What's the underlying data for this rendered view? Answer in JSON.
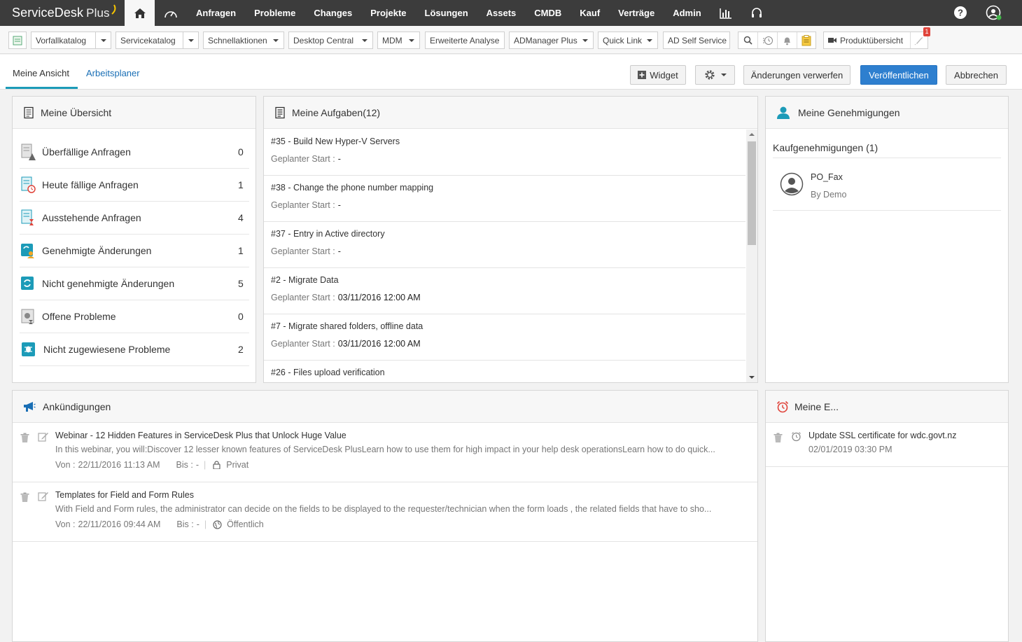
{
  "app": {
    "brand": "ServiceDesk",
    "brand_plus": "Plus"
  },
  "nav": {
    "items": [
      "Anfragen",
      "Probleme",
      "Changes",
      "Projekte",
      "Lösungen",
      "Assets",
      "CMDB",
      "Kauf",
      "Verträge",
      "Admin"
    ]
  },
  "toolbar": {
    "items": [
      {
        "label": "Vorfallkatalog"
      },
      {
        "label": "Servicekatalog"
      },
      {
        "label": "Schnellaktionen"
      },
      {
        "label": "Desktop Central"
      },
      {
        "label": "MDM"
      },
      {
        "label": "Erweiterte Analyse"
      },
      {
        "label": "ADManager Plus"
      },
      {
        "label": "Quick Link"
      },
      {
        "label": "AD Self Service"
      }
    ],
    "product_overview": "Produktübersicht",
    "notification_count": "1"
  },
  "tabs": {
    "my_view": "Meine Ansicht",
    "scheduler": "Arbeitsplaner"
  },
  "actions": {
    "widget": "Widget",
    "discard": "Änderungen verwerfen",
    "publish": "Veröffentlichen",
    "cancel": "Abbrechen"
  },
  "overview": {
    "title": "Meine Übersicht",
    "rows": [
      {
        "label": "Überfällige Anfragen",
        "count": "0",
        "icon": "overdue-requests-icon"
      },
      {
        "label": "Heute fällige Anfragen",
        "count": "1",
        "icon": "due-today-icon"
      },
      {
        "label": "Ausstehende Anfragen",
        "count": "4",
        "icon": "pending-requests-icon"
      },
      {
        "label": "Genehmigte Änderungen",
        "count": "1",
        "icon": "approved-changes-icon"
      },
      {
        "label": "Nicht genehmigte Änderungen",
        "count": "5",
        "icon": "unapproved-changes-icon"
      },
      {
        "label": "Offene Probleme",
        "count": "0",
        "icon": "open-problems-icon"
      },
      {
        "label": "Nicht zugewiesene Probleme",
        "count": "2",
        "icon": "unassigned-problems-icon"
      }
    ]
  },
  "tasks": {
    "title": "Meine Aufgaben(12)",
    "start_label": "Geplanter Start :",
    "items": [
      {
        "title": "#35 - Build New Hyper-V Servers",
        "start": "-"
      },
      {
        "title": "#38 - Change the phone number mapping",
        "start": "-"
      },
      {
        "title": "#37 - Entry in Active directory",
        "start": "-"
      },
      {
        "title": "#2 - Migrate Data",
        "start": "03/11/2016 12:00 AM"
      },
      {
        "title": "#7 - Migrate shared folders, offline data",
        "start": "03/11/2016 12:00 AM"
      },
      {
        "title": "#26 - Files upload verification",
        "start": ""
      }
    ]
  },
  "approvals": {
    "title": "Meine Genehmigungen",
    "section": "Kaufgenehmigungen (1)",
    "item": {
      "name": "PO_Fax",
      "by": "By Demo"
    }
  },
  "announcements": {
    "title": "Ankündigungen",
    "from_label": "Von :",
    "to_label": "Bis :",
    "items": [
      {
        "title": "Webinar - 12 Hidden Features in ServiceDesk Plus that Unlock Huge Value",
        "desc": "In this webinar, you will:Discover 12 lesser known features of ServiceDesk PlusLearn how to use them for high impact in your help desk operationsLearn how to do quick...",
        "from": "22/11/2016 11:13 AM",
        "to": "-",
        "visibility": "Privat"
      },
      {
        "title": "Templates for Field and Form Rules",
        "desc": "With Field and Form rules, the administrator can decide on the fields to be displayed to the requester/technician when the form loads , the related fields that have to sho...",
        "from": "22/11/2016 09:44 AM",
        "to": "-",
        "visibility": "Öffentlich"
      }
    ]
  },
  "events": {
    "title": "Meine E...",
    "item": {
      "title": "Update SSL certificate for wdc.govt.nz",
      "date": "02/01/2019 03:30 PM"
    }
  },
  "colors": {
    "topbar": "#3c3c3c",
    "primary": "#2e7fcf",
    "teal": "#1c9bb8",
    "link": "#1a6fb5"
  }
}
